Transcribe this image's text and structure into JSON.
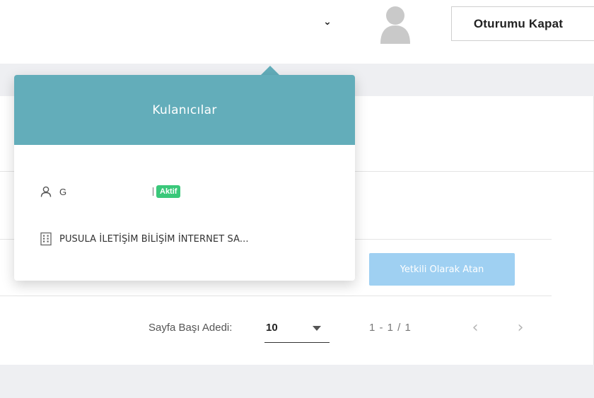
{
  "header": {
    "logout_label": "Oturumu Kapat",
    "caret_glyph": "⌄"
  },
  "popover": {
    "title": "Kulanıcılar",
    "user": {
      "name": "G",
      "status_badge": "Aktif"
    },
    "company": {
      "name": "PUSULA İLETİŞİM BİLİŞİM İNTERNET SA..."
    }
  },
  "actions": {
    "assign_label": "Yetkili Olarak Atan"
  },
  "pagination": {
    "page_size_label": "Sayfa Başı Adedi:",
    "page_size_value": "10",
    "range": "1 - 1 / 1",
    "prev_glyph": "‹",
    "next_glyph": "›"
  },
  "colors": {
    "popover_header": "#63adba",
    "badge_active": "#3ac87a",
    "assign_button": "#9fd0f2"
  }
}
